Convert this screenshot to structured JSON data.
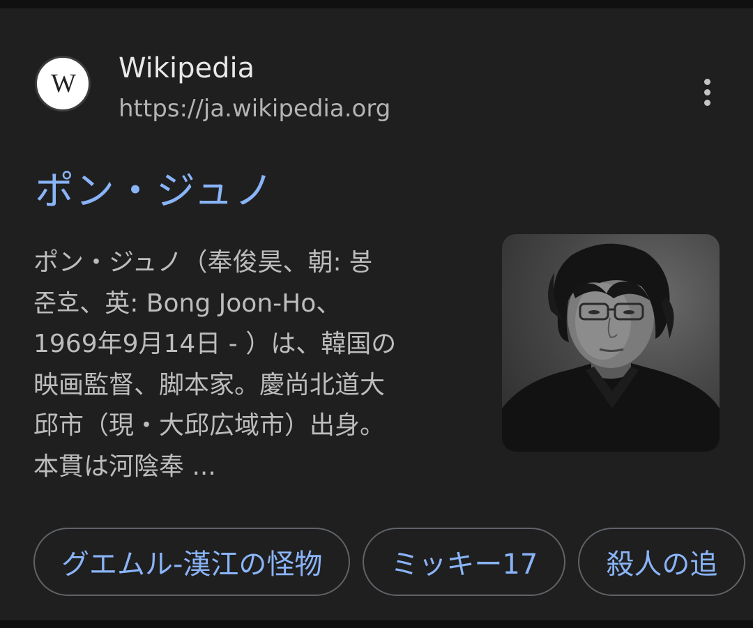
{
  "source": {
    "logo_letter": "W",
    "name": "Wikipedia",
    "url": "https://ja.wikipedia.org"
  },
  "result": {
    "title": "ポン・ジュノ",
    "snippet_lines": [
      "ポン・ジュノ（奉俊昊、朝: 봉",
      "준호、英: Bong Joon-Ho、",
      "1969年9月14日 - ）は、韓国の",
      "映画監督、脚本家。慶尚北道大",
      "邱市（現・大邱広域市）出身。",
      "本貫は河陰奉 ..."
    ]
  },
  "chips": [
    {
      "label": "グエムル-漢江の怪物"
    },
    {
      "label": "ミッキー17"
    },
    {
      "label": "殺人の追"
    }
  ],
  "colors": {
    "page_background": "#101010",
    "card_background": "#1f1f1f",
    "link_blue": "#8ab4f8",
    "snippet_gray": "#bdbdbd",
    "chip_border": "#5f6368"
  }
}
